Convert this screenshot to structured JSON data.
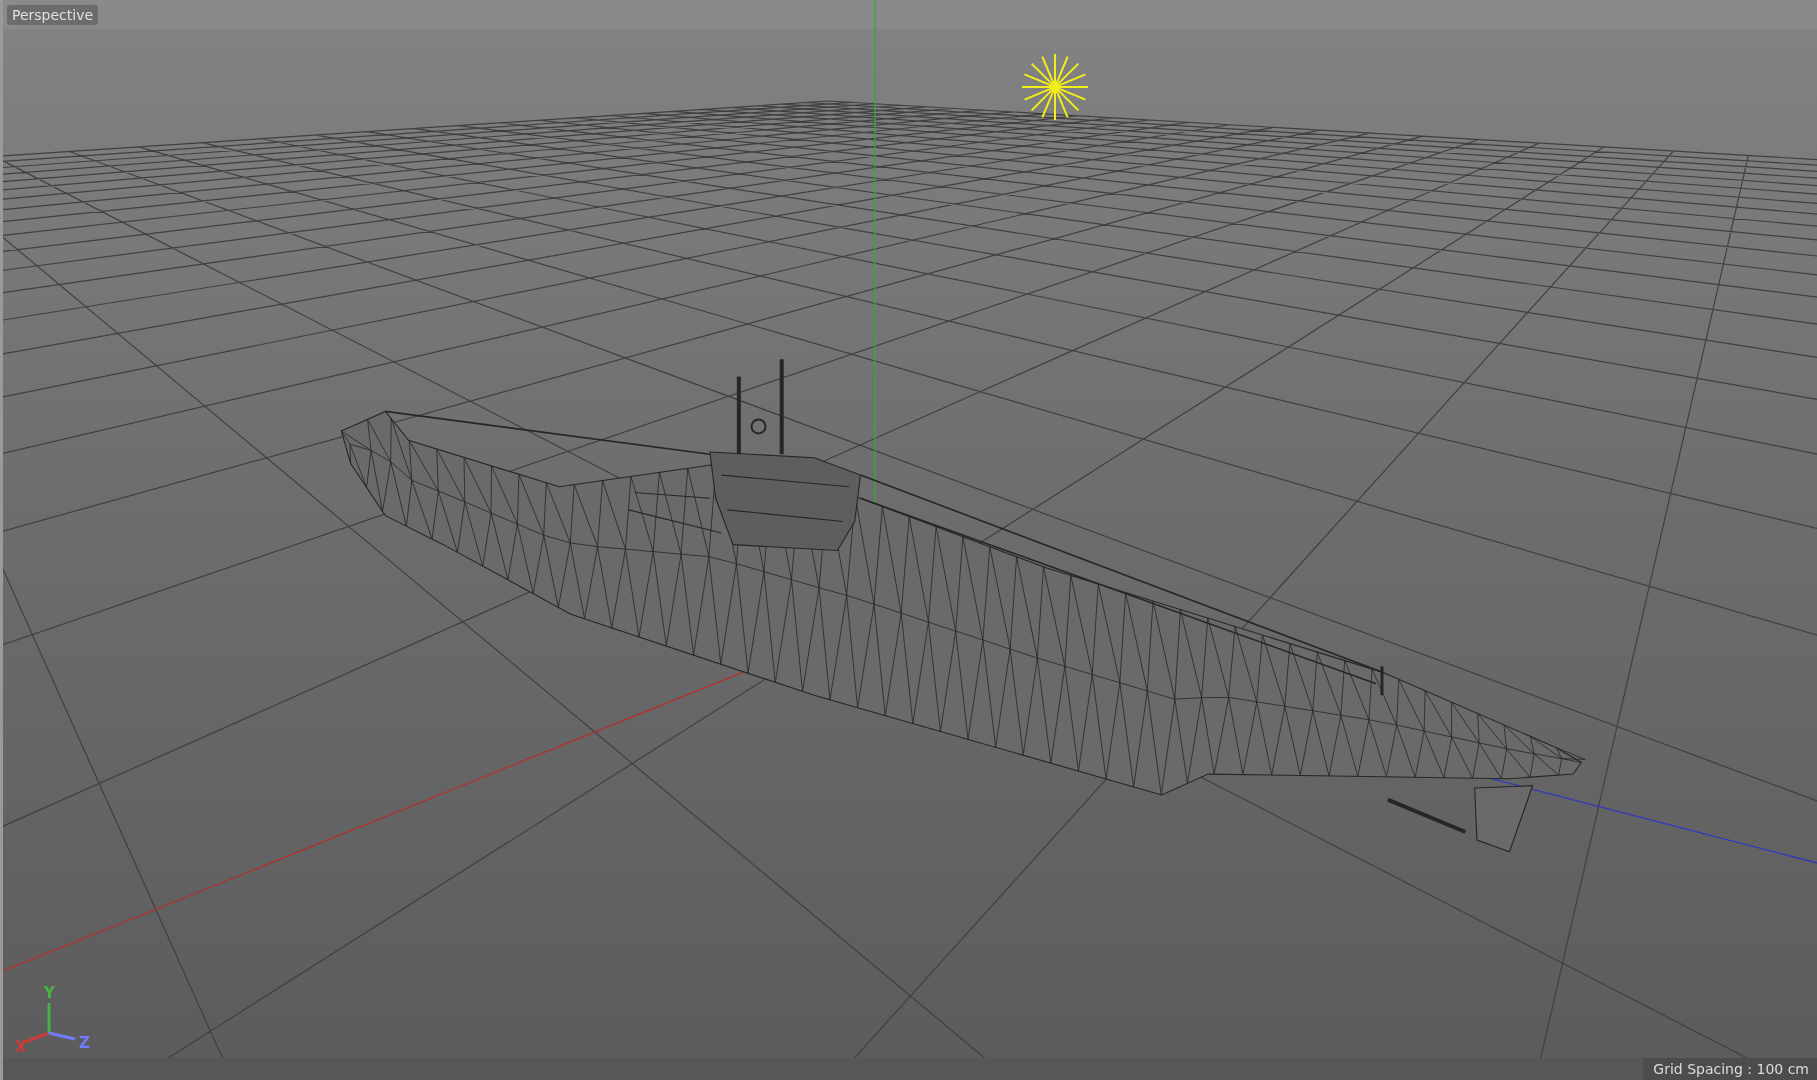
{
  "viewport": {
    "view_label": "Perspective",
    "axis_gizmo": [
      {
        "label": "X",
        "color": "#c83c3c"
      },
      {
        "label": "Y",
        "color": "#46b446"
      },
      {
        "label": "Z",
        "color": "#6f7cff"
      }
    ]
  },
  "status_bar": {
    "grid_spacing": "Grid Spacing : 100 cm"
  }
}
